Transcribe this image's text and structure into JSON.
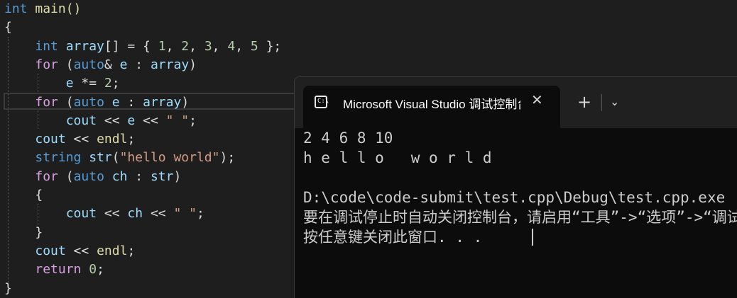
{
  "editor": {
    "lines": [
      [
        {
          "t": "int",
          "c": "ty"
        },
        {
          "t": " main()",
          "c": "fn"
        }
      ],
      [
        {
          "t": "{",
          "c": "pl"
        }
      ],
      [
        {
          "t": "    "
        },
        {
          "t": "int",
          "c": "ty"
        },
        {
          "t": " array",
          "c": "var"
        },
        {
          "t": "[] = { ",
          "c": "pl"
        },
        {
          "t": "1",
          "c": "num"
        },
        {
          "t": ", ",
          "c": "pl"
        },
        {
          "t": "2",
          "c": "num"
        },
        {
          "t": ", ",
          "c": "pl"
        },
        {
          "t": "3",
          "c": "num"
        },
        {
          "t": ", ",
          "c": "pl"
        },
        {
          "t": "4",
          "c": "num"
        },
        {
          "t": ", ",
          "c": "pl"
        },
        {
          "t": "5",
          "c": "num"
        },
        {
          "t": " };",
          "c": "pl"
        }
      ],
      [
        {
          "t": "    "
        },
        {
          "t": "for",
          "c": "ctl"
        },
        {
          "t": " (",
          "c": "pl"
        },
        {
          "t": "auto",
          "c": "kw"
        },
        {
          "t": "& ",
          "c": "pl"
        },
        {
          "t": "e",
          "c": "var"
        },
        {
          "t": " : ",
          "c": "pl"
        },
        {
          "t": "array",
          "c": "var"
        },
        {
          "t": ")",
          "c": "pl"
        }
      ],
      [
        {
          "t": "        "
        },
        {
          "t": "e",
          "c": "var"
        },
        {
          "t": " *= ",
          "c": "pl"
        },
        {
          "t": "2",
          "c": "num"
        },
        {
          "t": ";",
          "c": "pl"
        }
      ],
      [
        {
          "t": "    "
        },
        {
          "t": "for",
          "c": "ctl"
        },
        {
          "t": " (",
          "c": "pl"
        },
        {
          "t": "auto",
          "c": "kw"
        },
        {
          "t": " ",
          "c": "pl"
        },
        {
          "t": "e",
          "c": "var"
        },
        {
          "t": " : ",
          "c": "pl"
        },
        {
          "t": "array",
          "c": "var"
        },
        {
          "t": ")",
          "c": "pl"
        }
      ],
      [
        {
          "t": "        "
        },
        {
          "t": "cout",
          "c": "var"
        },
        {
          "t": " << ",
          "c": "pl"
        },
        {
          "t": "e",
          "c": "var"
        },
        {
          "t": " << ",
          "c": "pl"
        },
        {
          "t": "\" \"",
          "c": "str"
        },
        {
          "t": ";",
          "c": "pl"
        }
      ],
      [
        {
          "t": "    "
        },
        {
          "t": "cout",
          "c": "var"
        },
        {
          "t": " << ",
          "c": "pl"
        },
        {
          "t": "endl",
          "c": "fn"
        },
        {
          "t": ";",
          "c": "pl"
        }
      ],
      [
        {
          "t": "    "
        },
        {
          "t": "string",
          "c": "ty"
        },
        {
          "t": " str",
          "c": "var"
        },
        {
          "t": "(",
          "c": "pl"
        },
        {
          "t": "\"hello world\"",
          "c": "str"
        },
        {
          "t": ");",
          "c": "pl"
        }
      ],
      [
        {
          "t": "    "
        },
        {
          "t": "for",
          "c": "ctl"
        },
        {
          "t": " (",
          "c": "pl"
        },
        {
          "t": "auto",
          "c": "kw"
        },
        {
          "t": " ",
          "c": "pl"
        },
        {
          "t": "ch",
          "c": "var"
        },
        {
          "t": " : ",
          "c": "pl"
        },
        {
          "t": "str",
          "c": "var"
        },
        {
          "t": ")",
          "c": "pl"
        }
      ],
      [
        {
          "t": "    "
        },
        {
          "t": "{",
          "c": "pl"
        }
      ],
      [
        {
          "t": "        "
        },
        {
          "t": "cout",
          "c": "var"
        },
        {
          "t": " << ",
          "c": "pl"
        },
        {
          "t": "ch",
          "c": "var"
        },
        {
          "t": " << ",
          "c": "pl"
        },
        {
          "t": "\" \"",
          "c": "str"
        },
        {
          "t": ";",
          "c": "pl"
        }
      ],
      [
        {
          "t": "    "
        },
        {
          "t": "}",
          "c": "pl"
        }
      ],
      [
        {
          "t": "    "
        },
        {
          "t": "cout",
          "c": "var"
        },
        {
          "t": " << ",
          "c": "pl"
        },
        {
          "t": "endl",
          "c": "fn"
        },
        {
          "t": ";",
          "c": "pl"
        }
      ],
      [
        {
          "t": "    "
        },
        {
          "t": "return",
          "c": "ctl"
        },
        {
          "t": " ",
          "c": "pl"
        },
        {
          "t": "0",
          "c": "num"
        },
        {
          "t": ";",
          "c": "pl"
        }
      ],
      [
        {
          "t": "}",
          "c": "pl"
        }
      ]
    ]
  },
  "console": {
    "tab_title": "Microsoft Visual Studio 调试控制台",
    "tab_icon_text": "C:\\",
    "close_glyph": "✕",
    "new_tab_glyph": "+",
    "dropdown_glyph": "⌄",
    "output": [
      "2 4 6 8 10",
      "h e l l o   w o r l d",
      "",
      "D:\\code\\code-submit\\test.cpp\\Debug\\test.cpp.exe",
      "要在调试停止时自动关闭控制台，请启用“工具”->“选项”->“调试”",
      "按任意键关闭此窗口. . ."
    ]
  },
  "colors": {
    "editor_bg": "#1e1e1e",
    "console_bg": "#0c0c0c",
    "titlebar_bg": "#202020",
    "keyword": "#569cd6",
    "control": "#d8a0df",
    "string": "#d69d85",
    "number": "#b5cea8",
    "variable": "#9cdcfe",
    "function": "#dcdcaa"
  }
}
